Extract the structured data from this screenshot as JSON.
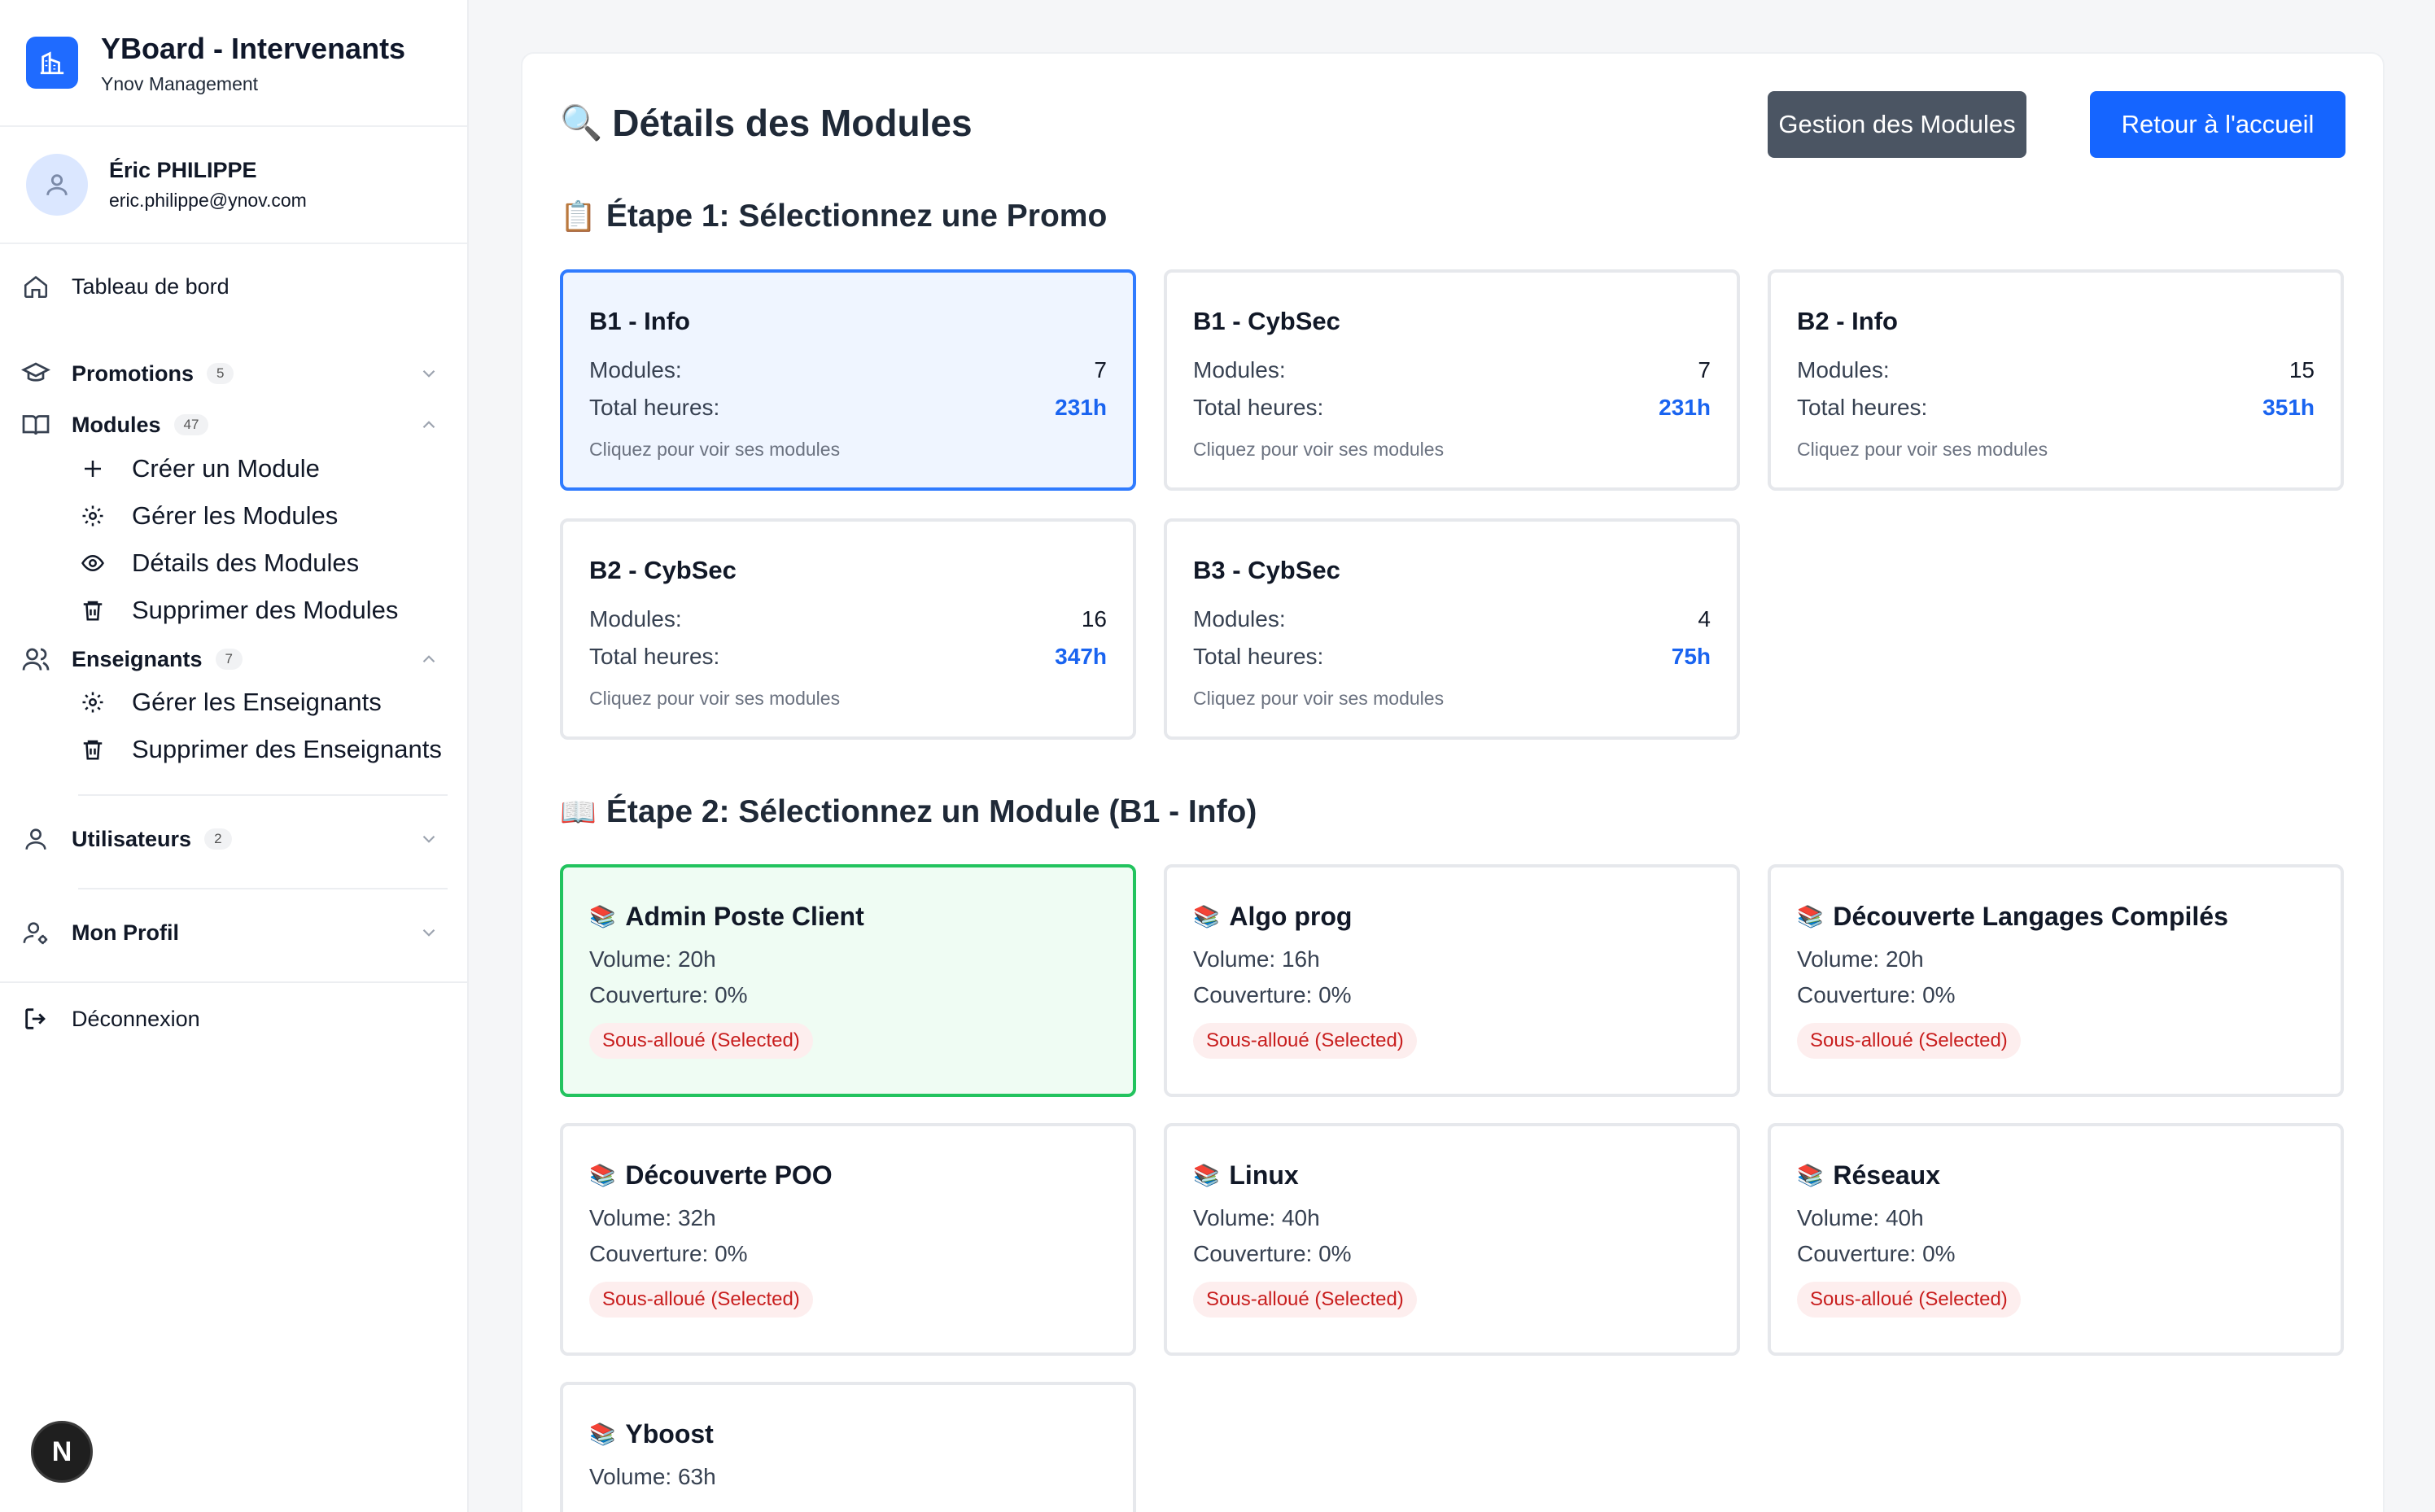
{
  "app": {
    "title": "YBoard - Intervenants",
    "subtitle": "Ynov Management"
  },
  "user": {
    "name": "Éric PHILIPPE",
    "email": "eric.philippe@ynov.com"
  },
  "sidebar": {
    "dashboard": "Tableau de bord",
    "promotions": {
      "label": "Promotions",
      "count": "5"
    },
    "modules": {
      "label": "Modules",
      "count": "47",
      "items": [
        "Créer un Module",
        "Gérer les Modules",
        "Détails des Modules",
        "Supprimer des Modules"
      ]
    },
    "enseignants": {
      "label": "Enseignants",
      "count": "7",
      "items": [
        "Gérer les Enseignants",
        "Supprimer des Enseignants"
      ]
    },
    "utilisateurs": {
      "label": "Utilisateurs",
      "count": "2"
    },
    "profil": "Mon Profil",
    "logout": "Déconnexion"
  },
  "header": {
    "emoji": "🔍",
    "title": "Détails des Modules",
    "btn_manage": "Gestion des Modules",
    "btn_home": "Retour à l'accueil"
  },
  "step1": {
    "emoji": "📋",
    "title": "Étape 1: Sélectionnez une Promo"
  },
  "promo_labels": {
    "modules": "Modules:",
    "hours": "Total heures:",
    "hint": "Cliquez pour voir ses modules"
  },
  "promos": [
    {
      "name": "B1 - Info",
      "modules": "7",
      "hours": "231h"
    },
    {
      "name": "B1 - CybSec",
      "modules": "7",
      "hours": "231h"
    },
    {
      "name": "B2 - Info",
      "modules": "15",
      "hours": "351h"
    },
    {
      "name": "B2 - CybSec",
      "modules": "16",
      "hours": "347h"
    },
    {
      "name": "B3 - CybSec",
      "modules": "4",
      "hours": "75h"
    }
  ],
  "step2": {
    "emoji": "📖",
    "title": "Étape 2: Sélectionnez un Module (B1 - Info)"
  },
  "module_emoji": "📚",
  "modules": [
    {
      "name": "Admin Poste Client",
      "volume": "Volume: 20h",
      "coverage": "Couverture: 0%",
      "status": "Sous-alloué (Selected)"
    },
    {
      "name": "Algo prog",
      "volume": "Volume: 16h",
      "coverage": "Couverture: 0%",
      "status": "Sous-alloué (Selected)"
    },
    {
      "name": "Découverte Langages Compilés",
      "volume": "Volume: 20h",
      "coverage": "Couverture: 0%",
      "status": "Sous-alloué (Selected)"
    },
    {
      "name": "Découverte POO",
      "volume": "Volume: 32h",
      "coverage": "Couverture: 0%",
      "status": "Sous-alloué (Selected)"
    },
    {
      "name": "Linux",
      "volume": "Volume: 40h",
      "coverage": "Couverture: 0%",
      "status": "Sous-alloué (Selected)"
    },
    {
      "name": "Réseaux",
      "volume": "Volume: 40h",
      "coverage": "Couverture: 0%",
      "status": "Sous-alloué (Selected)"
    },
    {
      "name": "Yboost",
      "volume": "Volume: 63h",
      "coverage": "",
      "status": ""
    }
  ],
  "fab": "N"
}
